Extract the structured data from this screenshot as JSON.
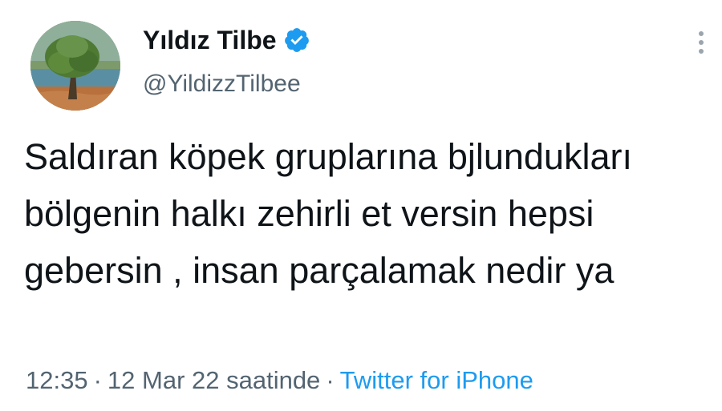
{
  "user": {
    "display_name": "Yıldız Tilbe",
    "handle": "@YildizzTilbee",
    "verified": true
  },
  "tweet": {
    "text": "Saldıran köpek gruplarına bjlundukları bölgenin halkı zehirli et versin hepsi gebersin , insan parçalamak nedir ya",
    "time": "12:35",
    "date": "12 Mar 22 saatinde",
    "separator": "·",
    "source": "Twitter for iPhone"
  },
  "icons": {
    "verified": "verified-badge-icon",
    "more": "more-options-icon"
  },
  "colors": {
    "text": "#0f1419",
    "secondary": "#536471",
    "accent": "#1d9bf0"
  }
}
